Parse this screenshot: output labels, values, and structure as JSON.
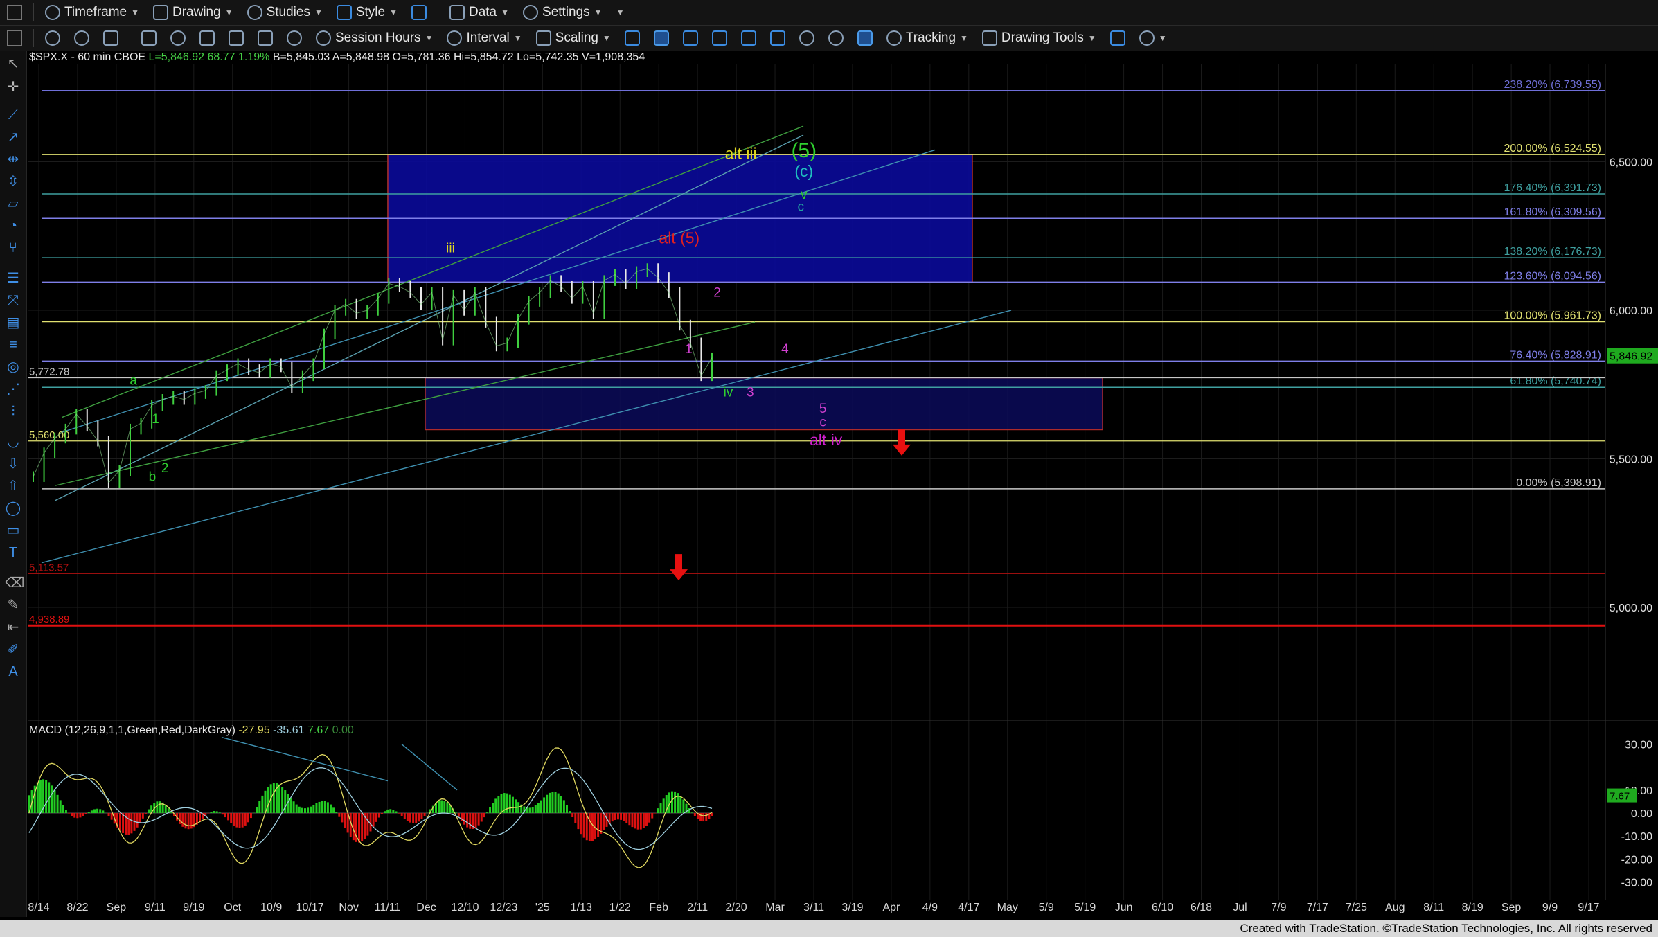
{
  "toolbar1": {
    "timeframe": "Timeframe",
    "drawing": "Drawing",
    "studies": "Studies",
    "style": "Style",
    "data": "Data",
    "settings": "Settings"
  },
  "toolbar2": {
    "session_hours": "Session Hours",
    "interval": "Interval",
    "scaling": "Scaling",
    "tracking": "Tracking",
    "drawing_tools": "Drawing Tools"
  },
  "symbol_info": {
    "symbol": "$SPX.X - 60 min  CBOE",
    "last": "L=5,846.92",
    "change": "68.77",
    "change_pct": "1.19%",
    "bid": "B=5,845.03",
    "ask": "A=5,848.98",
    "open": "O=5,781.36",
    "high": "Hi=5,854.72",
    "low": "Lo=5,742.35",
    "volume": "V=1,908,354"
  },
  "macd_info": {
    "label": "MACD (12,26,9,1,1,Green,Red,DarkGray)",
    "v1": "-27.95",
    "v2": "-35.61",
    "v3": "7.67",
    "v4": "0.00"
  },
  "footer": "Created with TradeStation. ©TradeStation Technologies, Inc. All rights reserved",
  "chart_data": {
    "type": "line",
    "title": "$SPX.X - 60 min",
    "y_price_axis": {
      "ylim": [
        4620,
        6830
      ],
      "ticks": [
        "6,500.00",
        "6,000.00",
        "5,500.00",
        "5,000.00"
      ],
      "tick_values": [
        6500,
        6000,
        5500,
        5000
      ]
    },
    "current_price": "5,846.92",
    "current_value": 5846.92,
    "fib_levels": [
      {
        "label": "238.20% (6,739.55)",
        "value": 6739.55,
        "color": "#6f6fd8"
      },
      {
        "label": "200.00% (6,524.55)",
        "value": 6524.55,
        "color": "#e0e070"
      },
      {
        "label": "176.40% (6,391.73)",
        "value": 6391.73,
        "color": "#3fa0a0"
      },
      {
        "label": "161.80% (6,309.56)",
        "value": 6309.56,
        "color": "#7f7fe8"
      },
      {
        "label": "138.20% (6,176.73)",
        "value": 6176.73,
        "color": "#3fa0a0"
      },
      {
        "label": "123.60% (6,094.56)",
        "value": 6094.56,
        "color": "#7f7fe8"
      },
      {
        "label": "100.00% (5,961.73)",
        "value": 5961.73,
        "color": "#e0e070"
      },
      {
        "label": "76.40% (5,828.91)",
        "value": 5828.91,
        "color": "#7f7fe8"
      },
      {
        "label": "61.80% (5,740.74)",
        "value": 5740.74,
        "color": "#3fa0a0"
      },
      {
        "label": "0.00% (5,398.91)",
        "value": 5398.91,
        "color": "#c8c8c8"
      }
    ],
    "support_levels": [
      {
        "label": "5,772.78",
        "value": 5772.78,
        "color": "#c8c8c8"
      },
      {
        "label": "5,560.00",
        "value": 5560.0,
        "color": "#e0e070"
      },
      {
        "label": "5,113.57",
        "value": 5113.57,
        "color": "#b01010"
      },
      {
        "label": "4,938.89",
        "value": 4938.89,
        "color": "#e01010"
      }
    ],
    "x_labels": [
      "8/14",
      "8/22",
      "Sep",
      "9/11",
      "9/19",
      "Oct",
      "10/9",
      "10/17",
      "Nov",
      "11/11",
      "Dec",
      "12/10",
      "12/23",
      "'25",
      "1/13",
      "1/22",
      "Feb",
      "2/11",
      "2/20",
      "Mar",
      "3/11",
      "3/19",
      "Apr",
      "4/9",
      "4/17",
      "May",
      "5/9",
      "5/19",
      "Jun",
      "6/10",
      "6/18",
      "Jul",
      "7/9",
      "7/17",
      "7/25",
      "Aug",
      "8/11",
      "8/19",
      "Sep",
      "9/9",
      "9/17"
    ],
    "price_series": [
      5440,
      5520,
      5570,
      5600,
      5650,
      5610,
      5560,
      5420,
      5460,
      5600,
      5620,
      5680,
      5700,
      5710,
      5700,
      5720,
      5730,
      5780,
      5800,
      5820,
      5800,
      5790,
      5820,
      5810,
      5740,
      5780,
      5820,
      5920,
      6000,
      6020,
      5990,
      6000,
      6040,
      6090,
      6080,
      6060,
      6020,
      6060,
      5900,
      6050,
      6000,
      6060,
      5960,
      5880,
      5890,
      5970,
      6030,
      6060,
      6100,
      6080,
      6040,
      6080,
      5990,
      6100,
      6120,
      6090,
      6130,
      6140,
      6110,
      6060,
      5950,
      5890,
      5780,
      5840
    ],
    "wave_labels": [
      {
        "text": "alt iii",
        "color": "#e0d820",
        "price": 6510,
        "x": 0.452
      },
      {
        "text": "(5)",
        "color": "#2fd02f",
        "price": 6515,
        "x": 0.492
      },
      {
        "text": "(c)",
        "color": "#20c0c0",
        "price": 6450,
        "x": 0.492
      },
      {
        "text": "v",
        "color": "#2fd02f",
        "price": 6375,
        "x": 0.492
      },
      {
        "text": "c",
        "color": "#20a0a0",
        "price": 6335,
        "x": 0.49
      },
      {
        "text": "alt (5)",
        "color": "#e02020",
        "price": 6225,
        "x": 0.413
      },
      {
        "text": "iii",
        "color": "#e0d820",
        "price": 6195,
        "x": 0.268
      },
      {
        "text": "2",
        "color": "#d040d0",
        "price": 6045,
        "x": 0.437
      },
      {
        "text": "1",
        "color": "#d040d0",
        "price": 5855,
        "x": 0.419
      },
      {
        "text": "4",
        "color": "#d040d0",
        "price": 5855,
        "x": 0.48
      },
      {
        "text": "iv",
        "color": "#2fd02f",
        "price": 5710,
        "x": 0.444
      },
      {
        "text": "3",
        "color": "#d040d0",
        "price": 5710,
        "x": 0.458
      },
      {
        "text": "5",
        "color": "#d040d0",
        "price": 5655,
        "x": 0.504
      },
      {
        "text": "c",
        "color": "#d040d0",
        "price": 5610,
        "x": 0.504
      },
      {
        "text": "alt iv",
        "color": "#d020d0",
        "price": 5545,
        "x": 0.506
      },
      {
        "text": "a",
        "color": "#2fd02f",
        "price": 5750,
        "x": 0.067
      },
      {
        "text": "1",
        "color": "#2fd02f",
        "price": 5620,
        "x": 0.081
      },
      {
        "text": "2",
        "color": "#2fd02f",
        "price": 5455,
        "x": 0.087
      },
      {
        "text": "b",
        "color": "#2fd02f",
        "price": 5425,
        "x": 0.079
      }
    ],
    "macd_axis": {
      "ticks": [
        "30.00",
        "10.00",
        "0.00",
        "-10.00",
        "-20.00",
        "-30.00"
      ],
      "tick_values": [
        30,
        10,
        0,
        -10,
        -20,
        -30
      ],
      "ylim": [
        -38,
        38
      ],
      "current": "7.67"
    }
  }
}
